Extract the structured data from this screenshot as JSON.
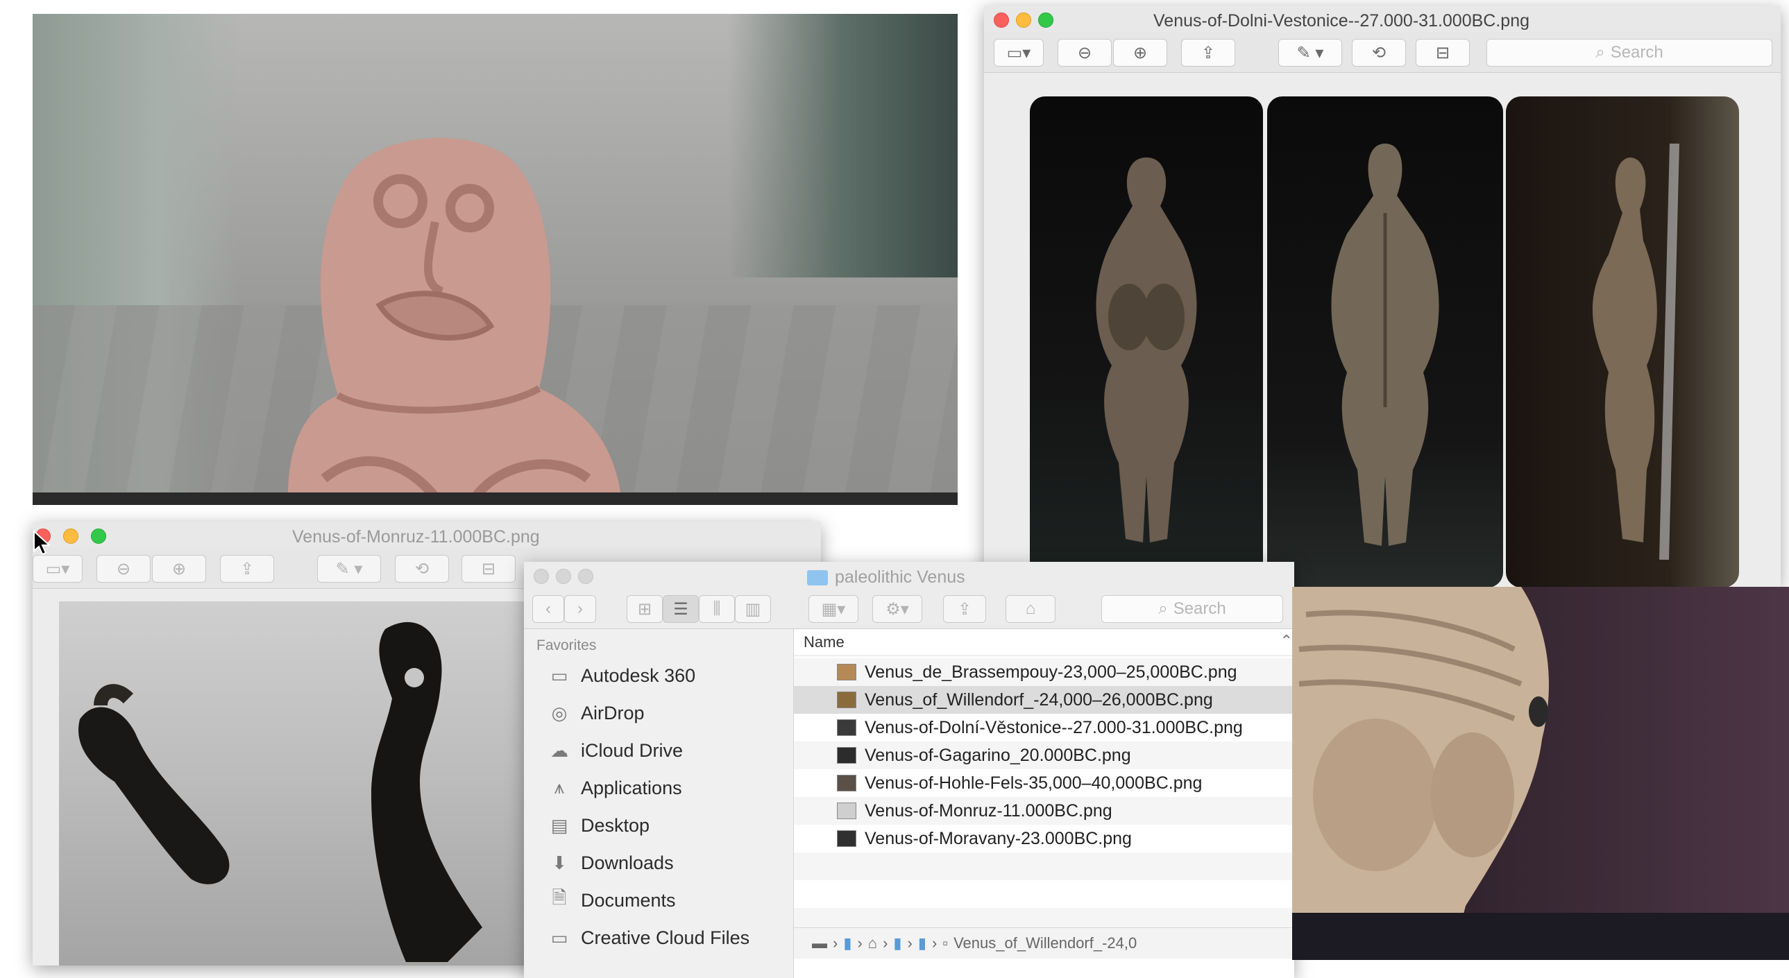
{
  "preview_dolni": {
    "title": "Venus-of-Dolni-Vestonice--27.000-31.000BC.png",
    "search_placeholder": "Search"
  },
  "preview_monruz": {
    "title": "Venus-of-Monruz-11.000BC.png"
  },
  "finder": {
    "title": "paleolithic Venus",
    "search_placeholder": "Search",
    "sidebar_heading": "Favorites",
    "sidebar_items": [
      {
        "label": "Autodesk 360",
        "icon": "folder-icon"
      },
      {
        "label": "AirDrop",
        "icon": "airdrop-icon"
      },
      {
        "label": "iCloud Drive",
        "icon": "cloud-icon"
      },
      {
        "label": "Applications",
        "icon": "applications-icon"
      },
      {
        "label": "Desktop",
        "icon": "desktop-icon"
      },
      {
        "label": "Downloads",
        "icon": "downloads-icon"
      },
      {
        "label": "Documents",
        "icon": "documents-icon"
      },
      {
        "label": "Creative Cloud Files",
        "icon": "folder-icon"
      }
    ],
    "column_name": "Name",
    "files": [
      {
        "name": "Venus_de_Brassempouy-23,000–25,000BC.png",
        "selected": false
      },
      {
        "name": "Venus_of_Willendorf_-24,000–26,000BC.png",
        "selected": true
      },
      {
        "name": "Venus-of-Dolní-Věstonice--27.000-31.000BC.png",
        "selected": false
      },
      {
        "name": "Venus-of-Gagarino_20.000BC.png",
        "selected": false
      },
      {
        "name": "Venus-of-Hohle-Fels-35,000–40,000BC.png",
        "selected": false
      },
      {
        "name": "Venus-of-Monruz-11.000BC.png",
        "selected": false
      },
      {
        "name": "Venus-of-Moravany-23.000BC.png",
        "selected": false
      }
    ],
    "path_end": "Venus_of_Willendorf_-24,0"
  },
  "colors": {
    "close": "#fc605c",
    "minimize": "#fdbc40",
    "zoom": "#34c84a",
    "selection": "#dcdcdc",
    "folder": "#8fc4ee"
  }
}
